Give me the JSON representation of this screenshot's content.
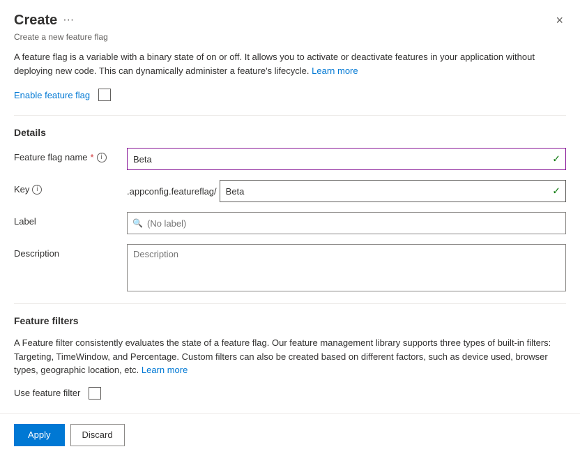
{
  "panel": {
    "title": "Create",
    "subtitle": "Create a new feature flag",
    "close_label": "×",
    "ellipsis_label": "···"
  },
  "description": {
    "text_before_link": "A feature flag is a variable with a binary state of on or off. It allows you to activate or deactivate features in your application without deploying new code. This can dynamically administer a feature's lifecycle.",
    "link_text": "Learn more",
    "link_href": "#"
  },
  "enable_feature_flag": {
    "label": "Enable feature flag"
  },
  "details": {
    "section_title": "Details",
    "feature_flag_name": {
      "label": "Feature flag name",
      "required": "*",
      "value": "Beta",
      "info_title": "Feature flag name info"
    },
    "key": {
      "label": "Key",
      "prefix": ".appconfig.featureflag/",
      "value": "Beta",
      "info_title": "Key info"
    },
    "label_field": {
      "label": "Label",
      "placeholder": "(No label)"
    },
    "description_field": {
      "label": "Description",
      "placeholder": "Description"
    }
  },
  "feature_filters": {
    "section_title": "Feature filters",
    "description": "A Feature filter consistently evaluates the state of a feature flag. Our feature management library supports three types of built-in filters: Targeting, TimeWindow, and Percentage. Custom filters can also be created based on different factors, such as device used, browser types, geographic location, etc.",
    "learn_more_text": "Learn more",
    "learn_more_href": "#",
    "use_filter_label": "Use feature filter"
  },
  "footer": {
    "apply_label": "Apply",
    "discard_label": "Discard"
  }
}
